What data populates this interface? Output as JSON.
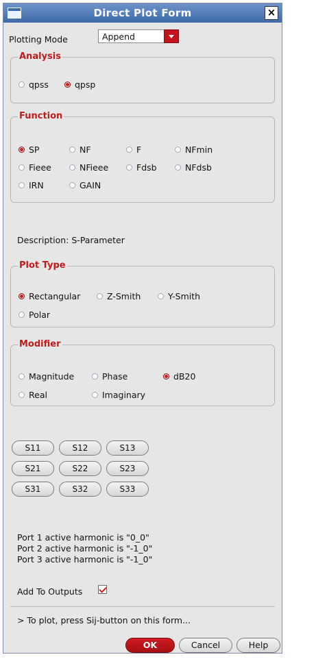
{
  "window": {
    "title": "Direct Plot Form",
    "close_glyph": "×"
  },
  "plotting_mode": {
    "label": "Plotting Mode",
    "value": "Append"
  },
  "analysis": {
    "legend": "Analysis",
    "options": [
      {
        "label": "qpss",
        "selected": false
      },
      {
        "label": "qpsp",
        "selected": true
      }
    ]
  },
  "function": {
    "legend": "Function",
    "options": [
      {
        "label": "SP",
        "selected": true
      },
      {
        "label": "NF",
        "selected": false
      },
      {
        "label": "F",
        "selected": false
      },
      {
        "label": "NFmin",
        "selected": false
      },
      {
        "label": "Fieee",
        "selected": false
      },
      {
        "label": "NFieee",
        "selected": false
      },
      {
        "label": "Fdsb",
        "selected": false
      },
      {
        "label": "NFdsb",
        "selected": false
      },
      {
        "label": "IRN",
        "selected": false
      },
      {
        "label": "GAIN",
        "selected": false
      }
    ]
  },
  "description": "Description: S-Parameter",
  "plot_type": {
    "legend": "Plot Type",
    "options": [
      {
        "label": "Rectangular",
        "selected": true
      },
      {
        "label": "Z-Smith",
        "selected": false
      },
      {
        "label": "Y-Smith",
        "selected": false
      },
      {
        "label": "Polar",
        "selected": false
      }
    ]
  },
  "modifier": {
    "legend": "Modifier",
    "options": [
      {
        "label": "Magnitude",
        "selected": false
      },
      {
        "label": "Phase",
        "selected": false
      },
      {
        "label": "dB20",
        "selected": true
      },
      {
        "label": "Real",
        "selected": false
      },
      {
        "label": "Imaginary",
        "selected": false
      }
    ]
  },
  "s_buttons": [
    [
      "S11",
      "S12",
      "S13"
    ],
    [
      "S21",
      "S22",
      "S23"
    ],
    [
      "S31",
      "S32",
      "S33"
    ]
  ],
  "harmonics": [
    "Port 1 active harmonic is \"0_0\"",
    "Port 2 active harmonic is \"-1_0\"",
    "Port 3 active harmonic is \"-1_0\""
  ],
  "add_to_outputs": {
    "label": "Add To Outputs",
    "checked": true
  },
  "status": "> To plot, press Sij-button on this form...",
  "buttons": {
    "ok": "OK",
    "cancel": "Cancel",
    "help": "Help"
  },
  "colors": {
    "accent": "#c1151b",
    "titlebar": "#3f6aaa",
    "legend": "#c01a1a"
  }
}
